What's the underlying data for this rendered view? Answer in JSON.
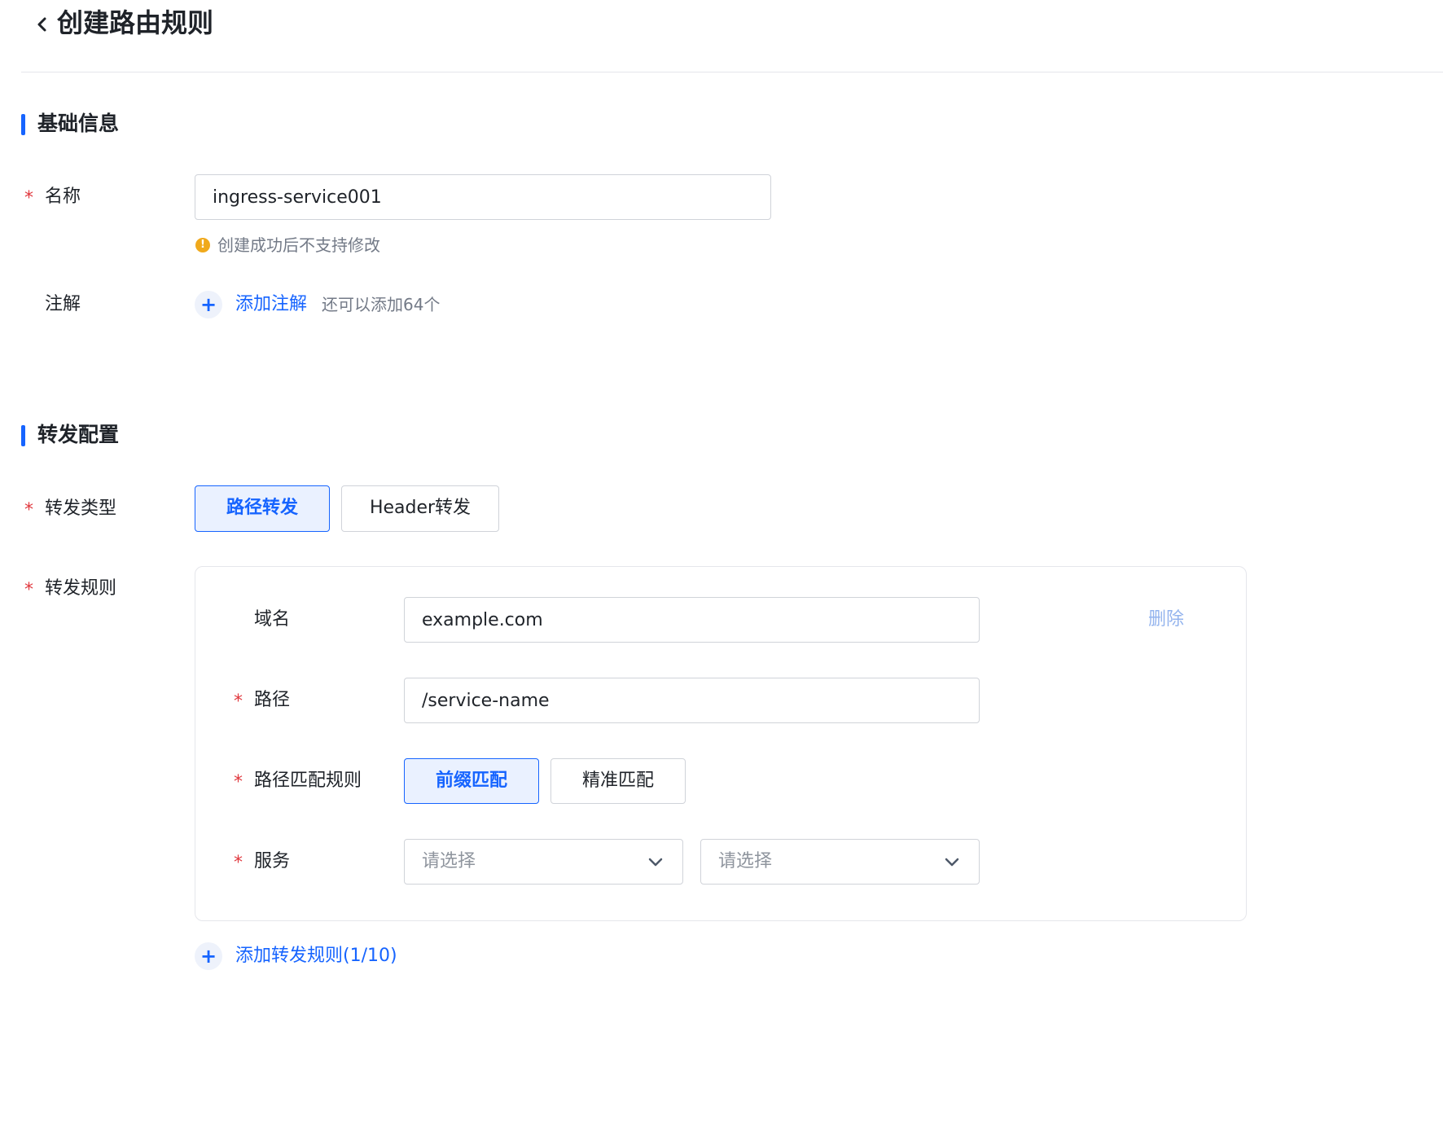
{
  "header": {
    "title": "创建路由规则"
  },
  "basic_info": {
    "section_title": "基础信息",
    "name": {
      "required_mark": "*",
      "label": "名称",
      "value": "ingress-service001",
      "hint_icon": "warning-icon",
      "hint_icon_glyph": "!",
      "hint": "创建成功后不支持修改"
    },
    "annotation": {
      "label": "注解",
      "add_icon": "plus-icon",
      "add_glyph": "+",
      "add_label": "添加注解",
      "remaining": "还可以添加64个"
    }
  },
  "forward_config": {
    "section_title": "转发配置",
    "forward_type": {
      "required_mark": "*",
      "label": "转发类型",
      "options": [
        "路径转发",
        "Header转发"
      ],
      "selected": "路径转发"
    },
    "forward_rules": {
      "required_mark": "*",
      "label": "转发规则",
      "rule": {
        "domain": {
          "label": "域名",
          "value": "example.com"
        },
        "delete_label": "删除",
        "path": {
          "required_mark": "*",
          "label": "路径",
          "value": "/service-name"
        },
        "match_rule": {
          "required_mark": "*",
          "label": "路径匹配规则",
          "options": [
            "前缀匹配",
            "精准匹配"
          ],
          "selected": "前缀匹配"
        },
        "service": {
          "required_mark": "*",
          "label": "服务",
          "select1_placeholder": "请选择",
          "select2_placeholder": "请选择",
          "dropdown_icon": "chevron-down-icon"
        }
      },
      "add_glyph": "+",
      "add_label": "添加转发规则(1/10)"
    }
  },
  "colors": {
    "primary": "#1664ff",
    "required": "#e0383e",
    "warning": "#f0a91c",
    "border": "#d0d3d9",
    "muted": "#737a87"
  }
}
